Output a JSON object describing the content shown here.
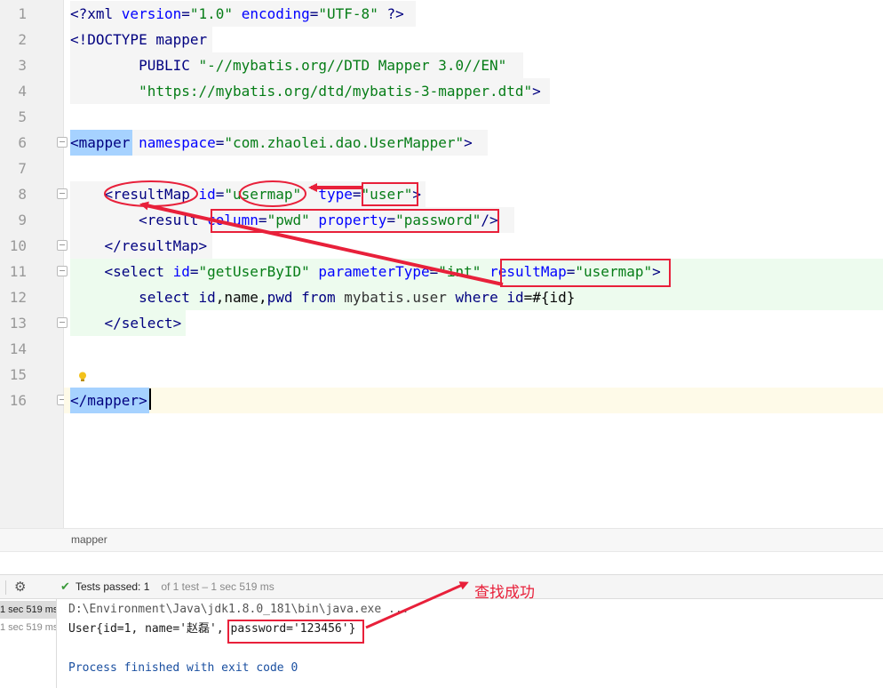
{
  "editor": {
    "line_numbers": [
      "1",
      "2",
      "3",
      "4",
      "5",
      "6",
      "7",
      "8",
      "9",
      "10",
      "11",
      "12",
      "13",
      "14",
      "15",
      "16"
    ],
    "lines": {
      "l1": {
        "a": "<?xml ",
        "b": "version",
        "c": "=",
        "d": "\"1.0\"",
        "e": " ",
        "f": "encoding",
        "g": "=",
        "h": "\"UTF-8\"",
        "i": " ?>"
      },
      "l2": {
        "a": "<!DOCTYPE ",
        "b": "mapper"
      },
      "l3": {
        "a": "        PUBLIC ",
        "b": "\"-//mybatis.org//DTD Mapper 3.0//EN\""
      },
      "l4": {
        "a": "        ",
        "b": "\"https://mybatis.org/dtd/mybatis-3-mapper.dtd\"",
        "c": ">"
      },
      "l6": {
        "a": "<mapper",
        "b": " ",
        "c": "namespace",
        "d": "=",
        "e": "\"com.zhaolei.dao.UserMapper\"",
        "f": ">"
      },
      "l8": {
        "a": "    <resultMap ",
        "b": "id",
        "c": "=",
        "d": "\"usermap\"",
        "e": "  ",
        "f": "type",
        "g": "=",
        "h": "\"user\"",
        "i": ">"
      },
      "l9": {
        "a": "        <result ",
        "b": "column",
        "c": "=",
        "d": "\"pwd\"",
        "e": " ",
        "f": "property",
        "g": "=",
        "h": "\"password\"",
        "i": "/>"
      },
      "l10": {
        "a": "    </resultMap>"
      },
      "l11": {
        "a": "    <select ",
        "b": "id",
        "c": "=",
        "d": "\"getUserByID\"",
        "e": " ",
        "f": "parameterType",
        "g": "=",
        "h": "\"int\"",
        "i": " ",
        "j": "resultMap",
        "k": "=",
        "l": "\"usermap\"",
        "m": ">"
      },
      "l12": {
        "a": "        ",
        "b": "select ",
        "c": "id",
        "d": ",",
        "e": "name",
        "f": ",",
        "g": "pwd",
        "h": " ",
        "i": "from ",
        "j": "mybatis.user ",
        "k": "where ",
        "l": "id",
        "m": "=#{id}"
      },
      "l13": {
        "a": "    </select>"
      },
      "l16": {
        "a": "</mapper",
        "b": ">"
      }
    }
  },
  "breadcrumb": {
    "item": "mapper"
  },
  "run_toolbar": {
    "settings_icon": "gear-icon",
    "status_icon": "check-icon",
    "tests_passed": "Tests passed: ",
    "tests_count": "1",
    "tests_detail": " of 1 test – 1 sec 519 ms"
  },
  "test_tree": {
    "rows": [
      "1 sec 519 ms",
      "1 sec 519 ms"
    ]
  },
  "console": {
    "line1": "D:\\Environment\\Java\\jdk1.8.0_181\\bin\\java.exe ...",
    "line2": "User{id=1, name='赵磊', password='123456'}",
    "line3": "Process finished with exit code 0"
  },
  "annotation": {
    "label": "查找成功",
    "color": "#e8203a"
  },
  "colors": {
    "tag": "#000080",
    "attribute": "#0000ff",
    "string": "#067d17",
    "selection": "#a6d2ff",
    "annotation_red": "#e8203a"
  }
}
